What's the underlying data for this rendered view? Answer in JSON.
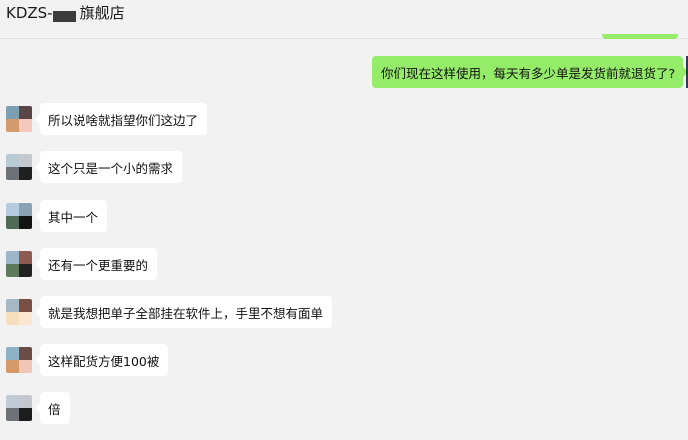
{
  "header": {
    "title_prefix": "KDZS-",
    "title_suffix": "旗舰店"
  },
  "sent_messages": [
    {
      "text": "你们现在这样使用，每天有多少单是发货前就退货了?"
    }
  ],
  "received_messages": [
    {
      "text": "所以说啥就指望你们这边了"
    },
    {
      "text": "这个只是一个小的需求"
    },
    {
      "text": "其中一个"
    },
    {
      "text": "还有一个更重要的"
    },
    {
      "text": "就是我想把单子全部挂在软件上，手里不想有面单"
    },
    {
      "text": "这样配货方便100被"
    },
    {
      "text": "倍"
    }
  ],
  "colors": {
    "sent_bubble": "#95ec69",
    "received_bubble": "#ffffff",
    "background": "#f2f2f2"
  }
}
